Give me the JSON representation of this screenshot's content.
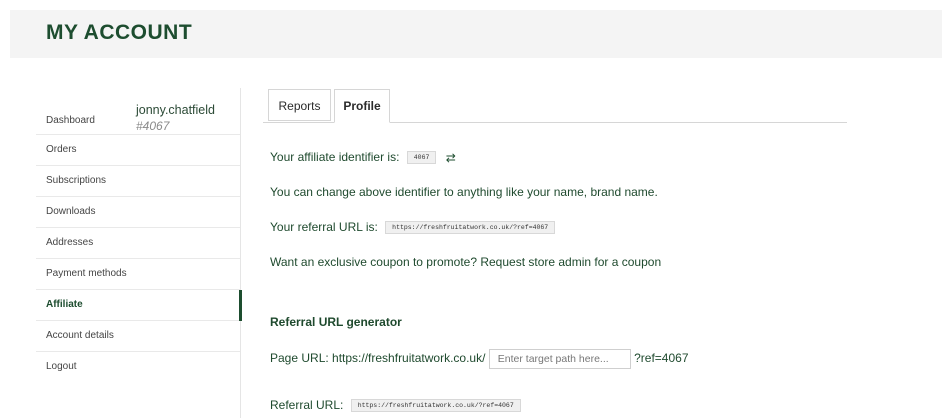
{
  "header": {
    "title": "MY ACCOUNT"
  },
  "user": {
    "dashboard_label": "Dashboard",
    "username": "jonny.chatfield",
    "user_id": "#4067"
  },
  "sidebar": {
    "items": [
      {
        "label": "Orders"
      },
      {
        "label": "Subscriptions"
      },
      {
        "label": "Downloads"
      },
      {
        "label": "Addresses"
      },
      {
        "label": "Payment methods"
      },
      {
        "label": "Affiliate"
      },
      {
        "label": "Account details"
      },
      {
        "label": "Logout"
      }
    ],
    "active": "Affiliate"
  },
  "tabs": {
    "reports": "Reports",
    "profile": "Profile"
  },
  "profile": {
    "identifier_text": "Your affiliate identifier is:",
    "identifier_value": "4067",
    "change_text": "You can change above identifier to anything like your name, brand name.",
    "referral_text": "Your referral URL is:",
    "referral_url": "https://freshfruitatwork.co.uk/?ref=4067",
    "coupon_text": "Want an exclusive coupon to promote? Request store admin for a coupon"
  },
  "generator": {
    "heading": "Referral URL generator",
    "page_url_label": "Page URL: https://freshfruitatwork.co.uk/",
    "path_placeholder": "Enter target path here...",
    "ref_suffix": "?ref=4067",
    "referral_url_label": "Referral URL:",
    "referral_url_value": "https://freshfruitatwork.co.uk/?ref=4067"
  },
  "icons": {
    "refresh": "refresh-icon"
  },
  "colors": {
    "brand": "#1d4d2f",
    "header_bg": "#f4f4f4"
  }
}
